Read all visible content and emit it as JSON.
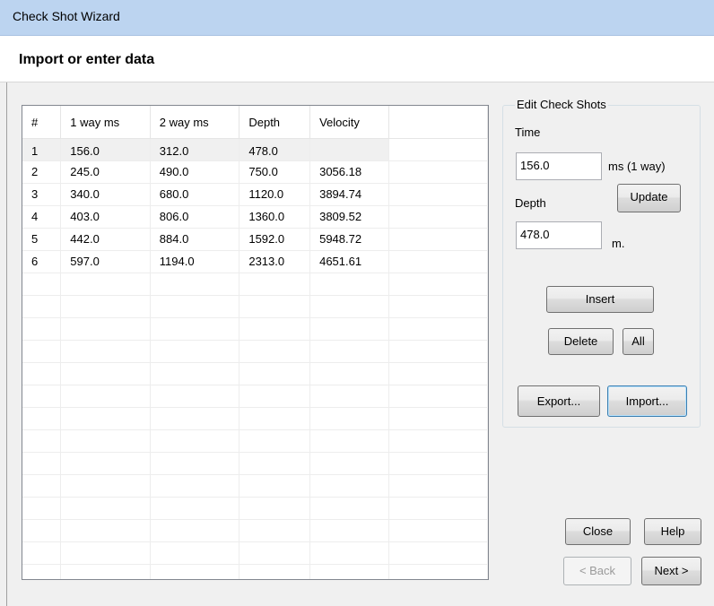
{
  "window": {
    "title": "Check Shot Wizard"
  },
  "header": {
    "heading": "Import or enter data"
  },
  "table": {
    "columns": [
      "#",
      "1 way ms",
      "2 way ms",
      "Depth",
      "Velocity",
      ""
    ],
    "rows": [
      [
        "1",
        "156.0",
        "312.0",
        "478.0",
        "",
        ""
      ],
      [
        "2",
        "245.0",
        "490.0",
        "750.0",
        "3056.18",
        ""
      ],
      [
        "3",
        "340.0",
        "680.0",
        "1120.0",
        "3894.74",
        ""
      ],
      [
        "4",
        "403.0",
        "806.0",
        "1360.0",
        "3809.52",
        ""
      ],
      [
        "5",
        "442.0",
        "884.0",
        "1592.0",
        "5948.72",
        ""
      ],
      [
        "6",
        "597.0",
        "1194.0",
        "2313.0",
        "4651.61",
        ""
      ]
    ],
    "selected_row": 0,
    "empty_rows": 14
  },
  "edit": {
    "group_title": "Edit Check Shots",
    "time_label": "Time",
    "time_value": "156.0",
    "time_unit": "ms (1 way)",
    "depth_label": "Depth",
    "depth_value": "478.0",
    "depth_unit": "m.",
    "update_label": "Update",
    "insert_label": "Insert",
    "delete_label": "Delete",
    "all_label": "All",
    "export_label": "Export...",
    "import_label": "Import..."
  },
  "footer": {
    "close_label": "Close",
    "help_label": "Help",
    "back_label": "< Back",
    "next_label": "Next >"
  }
}
